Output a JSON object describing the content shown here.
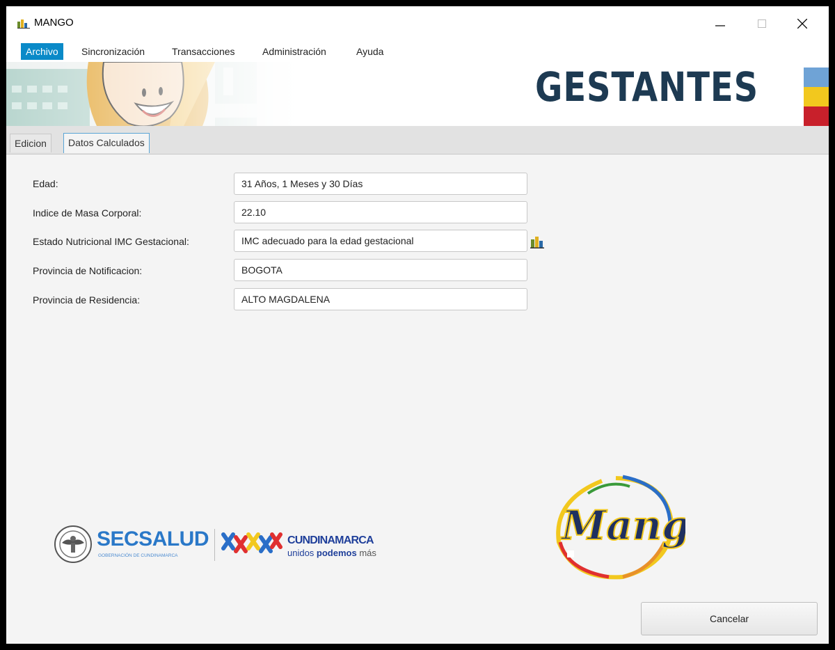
{
  "window": {
    "title": "MANGO"
  },
  "menu": {
    "items": [
      "Archivo",
      "Sincronización",
      "Transacciones",
      "Administración",
      "Ayuda"
    ]
  },
  "banner": {
    "title": "GESTANTES"
  },
  "tabs": [
    "Edicion",
    "Datos Calculados"
  ],
  "form": {
    "fields": [
      {
        "label": "Edad:",
        "value": "31 Años, 1 Meses y 30 Días"
      },
      {
        "label": "Indice de Masa Corporal:",
        "value": "22.10"
      },
      {
        "label": "Estado Nutricional IMC Gestacional:",
        "value": "IMC adecuado para la edad gestacional"
      },
      {
        "label": "Provincia de Notificacion:",
        "value": "BOGOTA"
      },
      {
        "label": "Provincia de Residencia:",
        "value": "ALTO MAGDALENA"
      }
    ]
  },
  "logos": {
    "secsalud": "SECSALUD",
    "secsalud_sub": "GOBERNACIÓN DE CUNDINAMARCA",
    "cundinamarca": "CUNDINAMARCA",
    "slogan_a": "unidos ",
    "slogan_b": "podemos",
    "slogan_c": " más",
    "mango": "Mango"
  },
  "buttons": {
    "cancel": "Cancelar"
  },
  "colors": {
    "accent": "#0a8ac8",
    "banner_text": "#1d3a52",
    "flag_blue": "#6fa3d6",
    "flag_yellow": "#f2c81e",
    "flag_red": "#c8202b"
  }
}
